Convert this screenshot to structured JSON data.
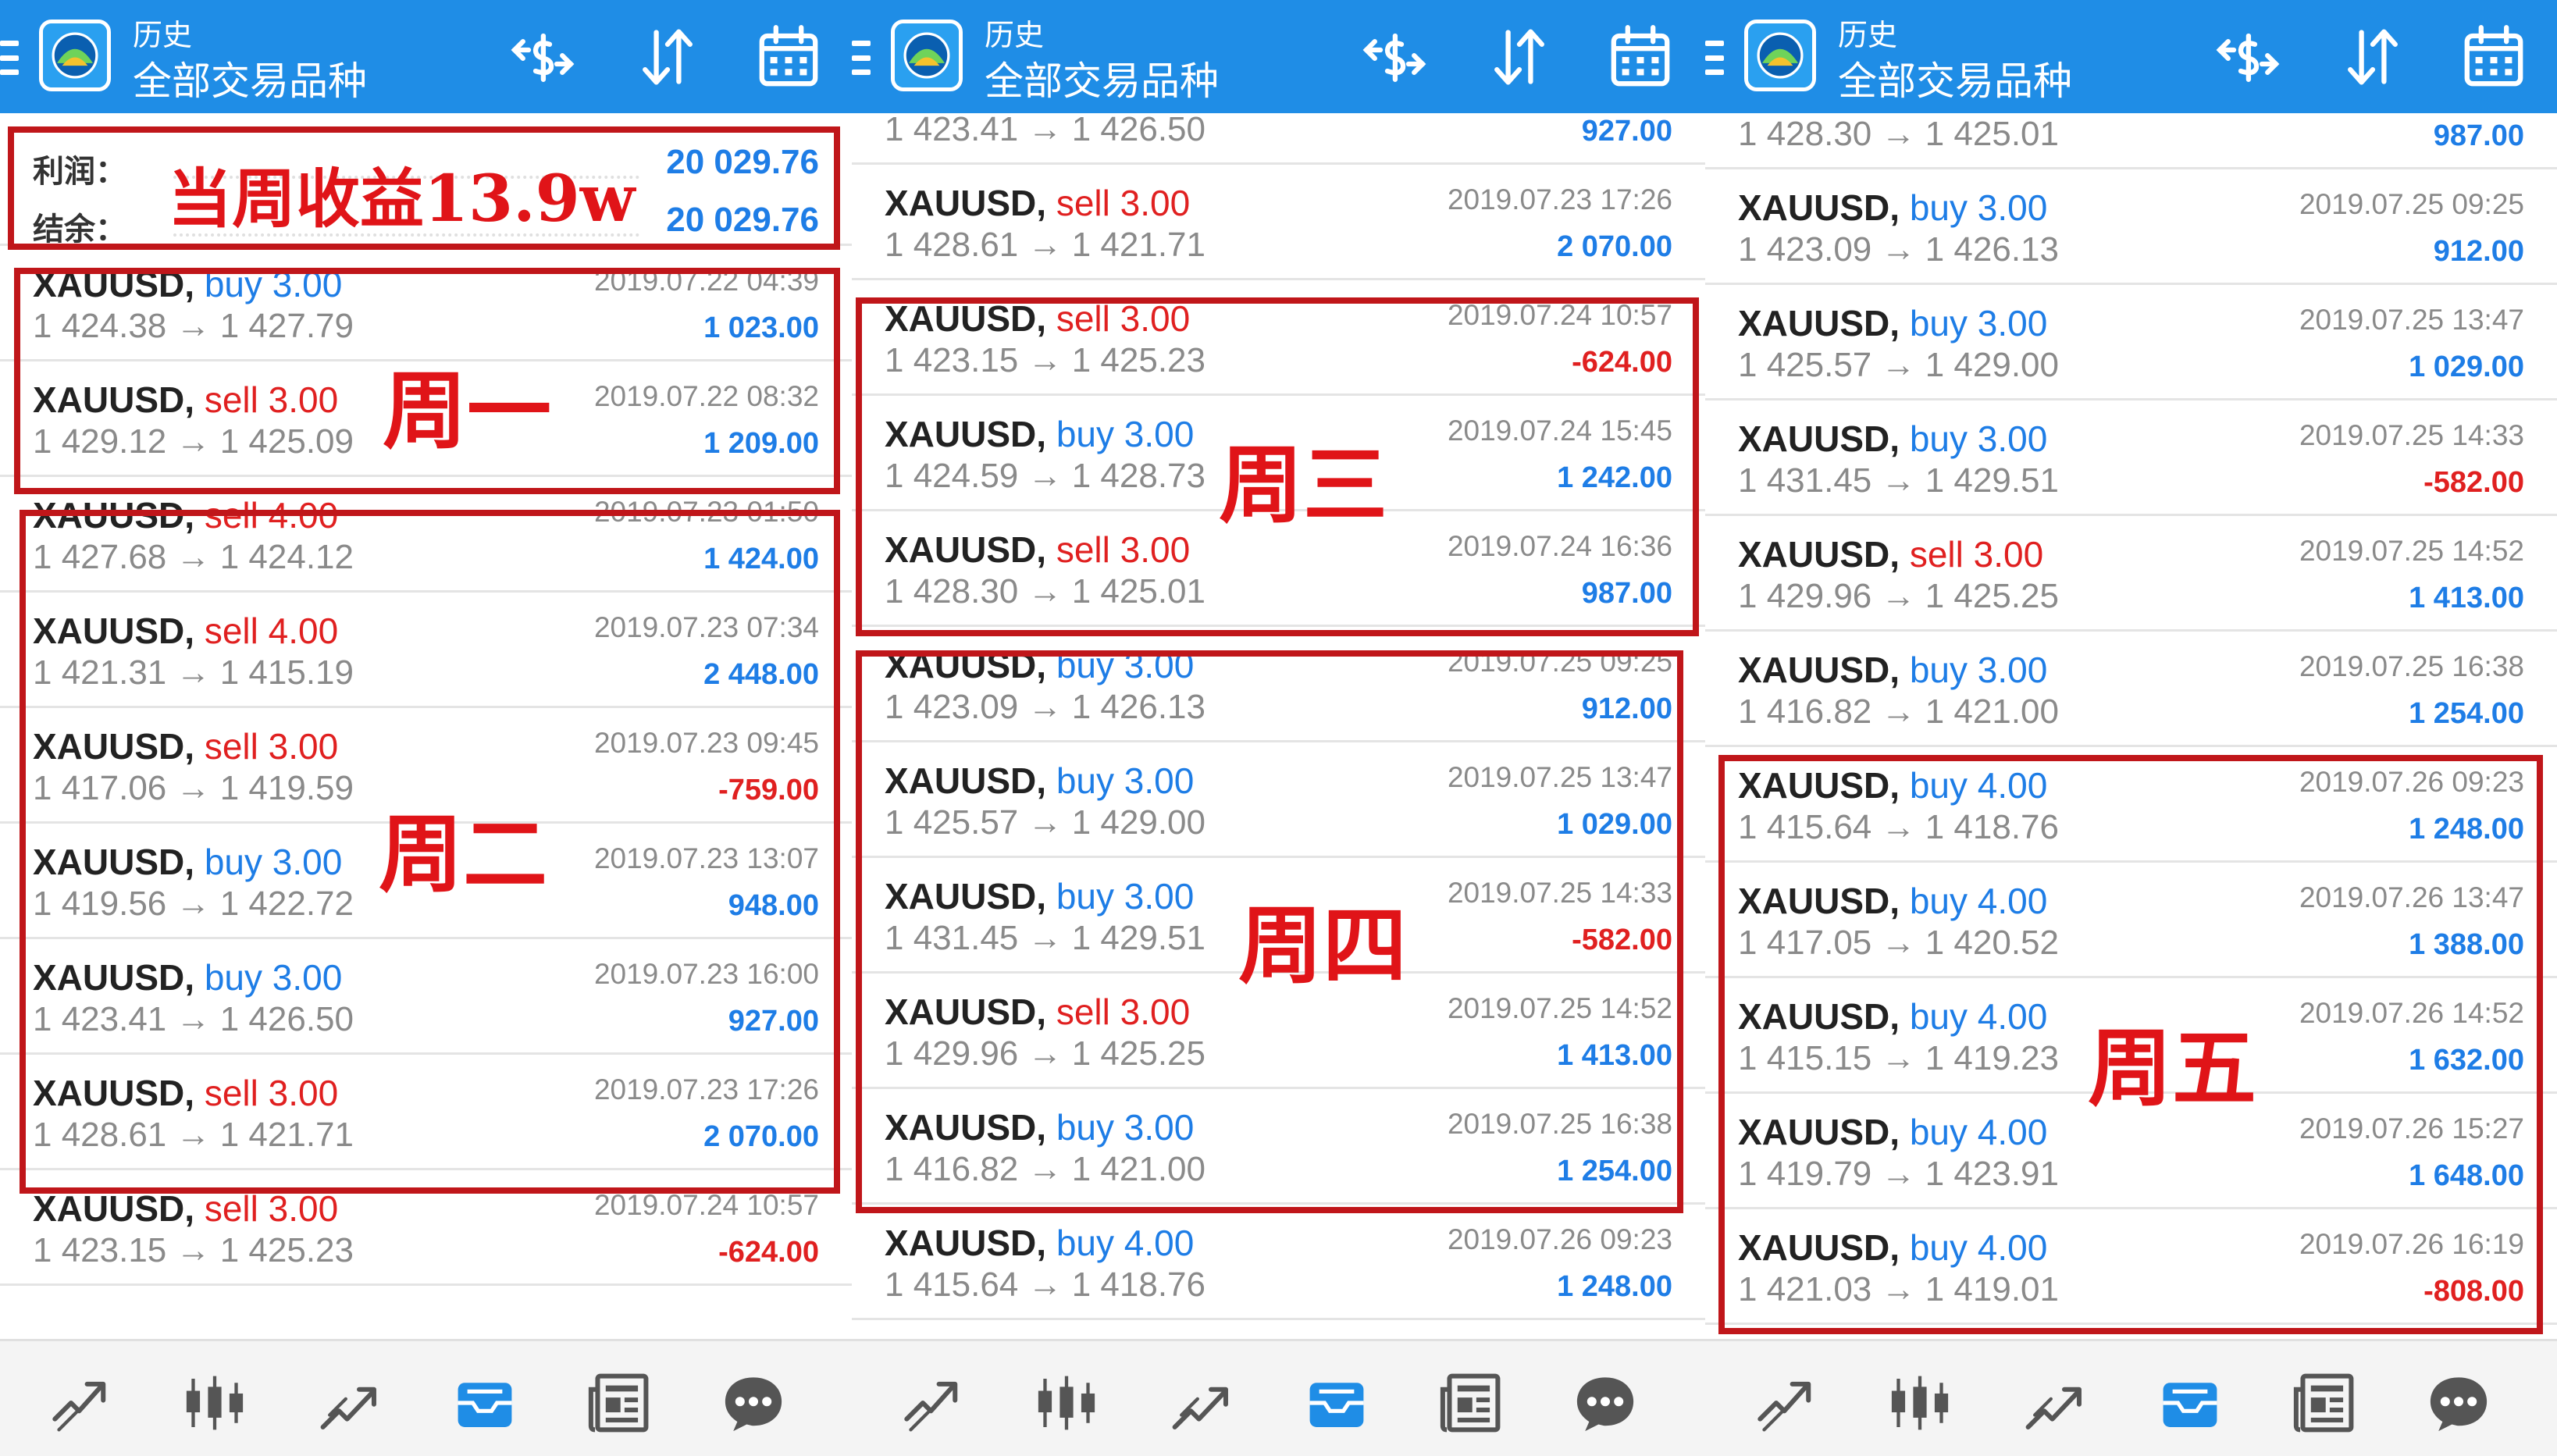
{
  "header": {
    "title": "历史",
    "subtitle": "全部交易品种"
  },
  "summary": {
    "profit_label": "利润：",
    "profit_value": "20 029.76",
    "balance_label": "结余：",
    "balance_value": "20 029.76"
  },
  "annotations": {
    "weekly": "当周收益13.9w",
    "mon": "周一",
    "tue": "周二",
    "wed": "周三",
    "thu": "周四",
    "fri": "周五"
  },
  "colors": {
    "header": "#1f8de6",
    "buy": "#1e7de6",
    "sell": "#e02020",
    "box": "#c0161a"
  },
  "icons": {
    "header": [
      "currency-exchange-icon",
      "sort-icon",
      "calendar-icon"
    ],
    "nav": [
      "quotes-icon",
      "chart-icon",
      "trade-icon",
      "history-icon",
      "news-icon",
      "chat-icon"
    ]
  },
  "trades": [
    {
      "sym": "XAUUSD,",
      "side": "buy",
      "vol": "3.00",
      "prices": "1 424.38 → 1 427.79",
      "time": "2019.07.22 04:39",
      "profit": "1 023.00"
    },
    {
      "sym": "XAUUSD,",
      "side": "sell",
      "vol": "3.00",
      "prices": "1 429.12 → 1 425.09",
      "time": "2019.07.22 08:32",
      "profit": "1 209.00"
    },
    {
      "sym": "XAUUSD,",
      "side": "sell",
      "vol": "4.00",
      "prices": "1 427.68 → 1 424.12",
      "time": "2019.07.23 01:50",
      "profit": "1 424.00"
    },
    {
      "sym": "XAUUSD,",
      "side": "sell",
      "vol": "4.00",
      "prices": "1 421.31 → 1 415.19",
      "time": "2019.07.23 07:34",
      "profit": "2 448.00"
    },
    {
      "sym": "XAUUSD,",
      "side": "sell",
      "vol": "3.00",
      "prices": "1 417.06 → 1 419.59",
      "time": "2019.07.23 09:45",
      "profit": "-759.00"
    },
    {
      "sym": "XAUUSD,",
      "side": "buy",
      "vol": "3.00",
      "prices": "1 419.56 → 1 422.72",
      "time": "2019.07.23 13:07",
      "profit": "948.00"
    },
    {
      "sym": "XAUUSD,",
      "side": "buy",
      "vol": "3.00",
      "prices": "1 423.41 → 1 426.50",
      "time": "2019.07.23 16:00",
      "profit": "927.00"
    },
    {
      "sym": "XAUUSD,",
      "side": "sell",
      "vol": "3.00",
      "prices": "1 428.61 → 1 421.71",
      "time": "2019.07.23 17:26",
      "profit": "2 070.00"
    },
    {
      "sym": "XAUUSD,",
      "side": "sell",
      "vol": "3.00",
      "prices": "1 423.15 → 1 425.23",
      "time": "2019.07.24 10:57",
      "profit": "-624.00"
    },
    {
      "sym": "XAUUSD,",
      "side": "buy",
      "vol": "3.00",
      "prices": "1 424.59 → 1 428.73",
      "time": "2019.07.24 15:45",
      "profit": "1 242.00"
    },
    {
      "sym": "XAUUSD,",
      "side": "sell",
      "vol": "3.00",
      "prices": "1 428.30 → 1 425.01",
      "time": "2019.07.24 16:36",
      "profit": "987.00"
    },
    {
      "sym": "XAUUSD,",
      "side": "buy",
      "vol": "3.00",
      "prices": "1 423.09 → 1 426.13",
      "time": "2019.07.25 09:25",
      "profit": "912.00"
    },
    {
      "sym": "XAUUSD,",
      "side": "buy",
      "vol": "3.00",
      "prices": "1 425.57 → 1 429.00",
      "time": "2019.07.25 13:47",
      "profit": "1 029.00"
    },
    {
      "sym": "XAUUSD,",
      "side": "buy",
      "vol": "3.00",
      "prices": "1 431.45 → 1 429.51",
      "time": "2019.07.25 14:33",
      "profit": "-582.00"
    },
    {
      "sym": "XAUUSD,",
      "side": "sell",
      "vol": "3.00",
      "prices": "1 429.96 → 1 425.25",
      "time": "2019.07.25 14:52",
      "profit": "1 413.00"
    },
    {
      "sym": "XAUUSD,",
      "side": "buy",
      "vol": "3.00",
      "prices": "1 416.82 → 1 421.00",
      "time": "2019.07.25 16:38",
      "profit": "1 254.00"
    },
    {
      "sym": "XAUUSD,",
      "side": "buy",
      "vol": "4.00",
      "prices": "1 415.64 → 1 418.76",
      "time": "2019.07.26 09:23",
      "profit": "1 248.00"
    },
    {
      "sym": "XAUUSD,",
      "side": "buy",
      "vol": "4.00",
      "prices": "1 417.05 → 1 420.52",
      "time": "2019.07.26 13:47",
      "profit": "1 388.00"
    },
    {
      "sym": "XAUUSD,",
      "side": "buy",
      "vol": "4.00",
      "prices": "1 415.15 → 1 419.23",
      "time": "2019.07.26 14:52",
      "profit": "1 632.00"
    },
    {
      "sym": "XAUUSD,",
      "side": "buy",
      "vol": "4.00",
      "prices": "1 419.79 → 1 423.91",
      "time": "2019.07.26 15:27",
      "profit": "1 648.00"
    },
    {
      "sym": "XAUUSD,",
      "side": "buy",
      "vol": "4.00",
      "prices": "1 421.03 → 1 419.01",
      "time": "2019.07.26 16:19",
      "profit": "-808.00"
    }
  ]
}
